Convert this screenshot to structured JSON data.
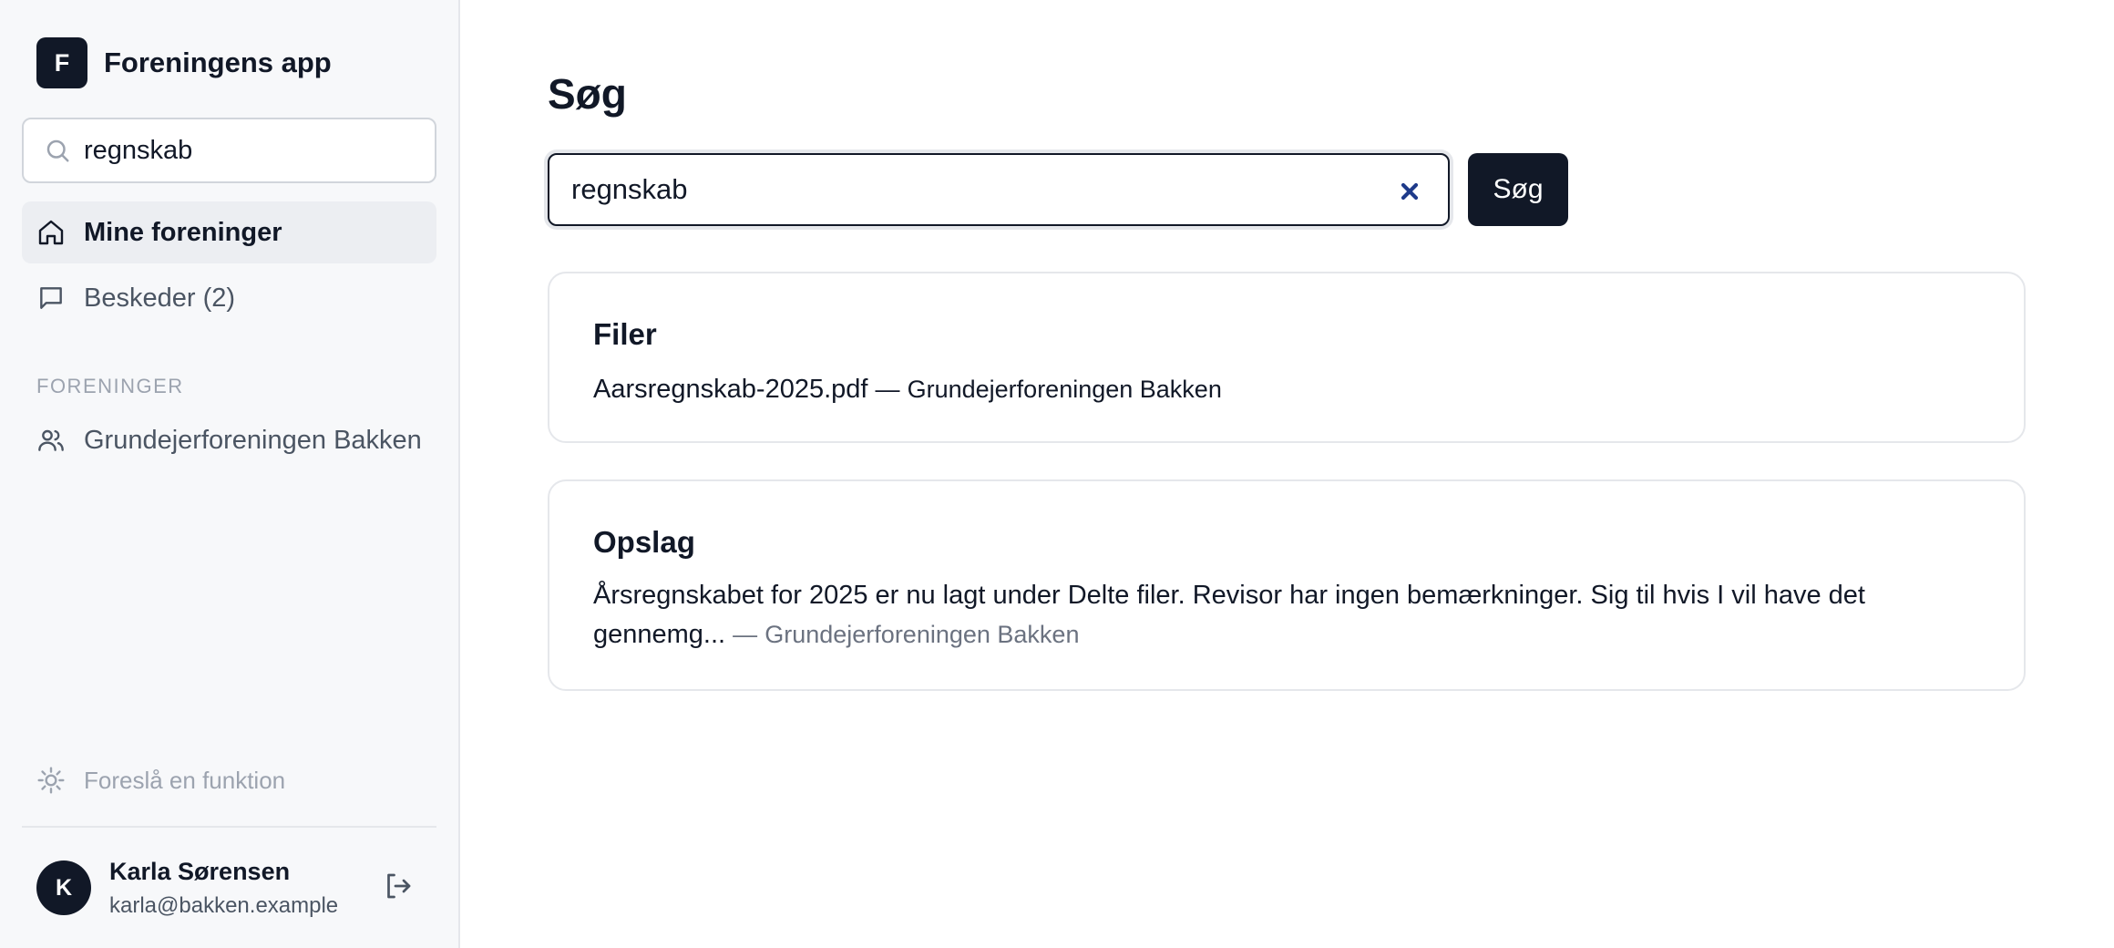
{
  "app": {
    "logo_letter": "F",
    "name": "Foreningens app"
  },
  "sidebar": {
    "search_value": "regnskab",
    "nav": [
      {
        "label": "Mine foreninger",
        "icon": "home-icon",
        "active": true
      },
      {
        "label": "Beskeder (2)",
        "icon": "message-icon",
        "active": false
      }
    ],
    "section_title": "FORENINGER",
    "groups": [
      {
        "label": "Grundejerforeningen Bakken",
        "icon": "users-icon"
      }
    ],
    "suggest_label": "Foreslå en funktion",
    "user": {
      "initial": "K",
      "name": "Karla Sørensen",
      "email": "karla@bakken.example"
    }
  },
  "main": {
    "title": "Søg",
    "search_value": "regnskab",
    "search_button": "Søg",
    "results": [
      {
        "section": "Filer",
        "text": "Aarsregnskab-2025.pdf",
        "separator": "—",
        "association": "Grundejerforeningen Bakken"
      },
      {
        "section": "Opslag",
        "text": "Årsregnskabet for 2025 er nu lagt under Delte filer. Revisor har ingen bemærkninger. Sig til hvis I vil have det gennemg...",
        "separator": "—",
        "association": "Grundejerforeningen Bakken"
      }
    ]
  },
  "colors": {
    "primary": "#111827",
    "sidebar_bg": "#f7f8fa",
    "active_nav_bg": "#eceef2",
    "muted_text": "#6b7280",
    "clear_icon": "#1e3a8a"
  }
}
